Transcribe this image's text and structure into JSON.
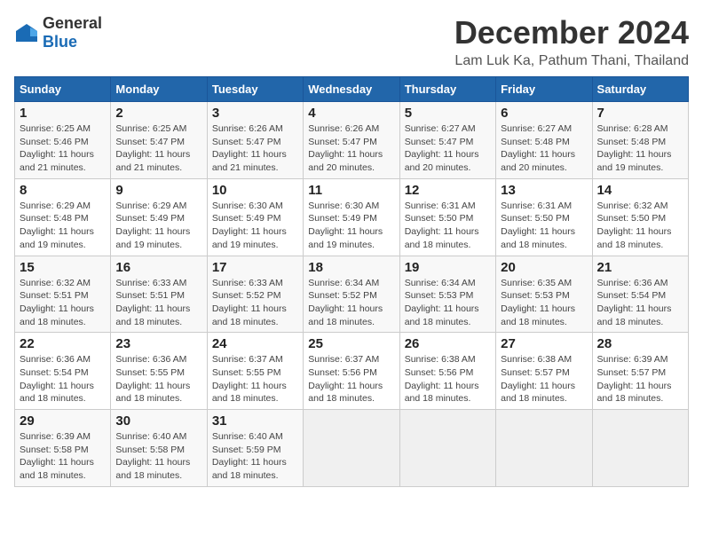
{
  "header": {
    "logo_general": "General",
    "logo_blue": "Blue",
    "title": "December 2024",
    "subtitle": "Lam Luk Ka, Pathum Thani, Thailand"
  },
  "weekdays": [
    "Sunday",
    "Monday",
    "Tuesday",
    "Wednesday",
    "Thursday",
    "Friday",
    "Saturday"
  ],
  "weeks": [
    [
      {
        "day": "1",
        "sunrise": "6:25 AM",
        "sunset": "5:46 PM",
        "daylight": "11 hours and 21 minutes."
      },
      {
        "day": "2",
        "sunrise": "6:25 AM",
        "sunset": "5:47 PM",
        "daylight": "11 hours and 21 minutes."
      },
      {
        "day": "3",
        "sunrise": "6:26 AM",
        "sunset": "5:47 PM",
        "daylight": "11 hours and 21 minutes."
      },
      {
        "day": "4",
        "sunrise": "6:26 AM",
        "sunset": "5:47 PM",
        "daylight": "11 hours and 20 minutes."
      },
      {
        "day": "5",
        "sunrise": "6:27 AM",
        "sunset": "5:47 PM",
        "daylight": "11 hours and 20 minutes."
      },
      {
        "day": "6",
        "sunrise": "6:27 AM",
        "sunset": "5:48 PM",
        "daylight": "11 hours and 20 minutes."
      },
      {
        "day": "7",
        "sunrise": "6:28 AM",
        "sunset": "5:48 PM",
        "daylight": "11 hours and 19 minutes."
      }
    ],
    [
      {
        "day": "8",
        "sunrise": "6:29 AM",
        "sunset": "5:48 PM",
        "daylight": "11 hours and 19 minutes."
      },
      {
        "day": "9",
        "sunrise": "6:29 AM",
        "sunset": "5:49 PM",
        "daylight": "11 hours and 19 minutes."
      },
      {
        "day": "10",
        "sunrise": "6:30 AM",
        "sunset": "5:49 PM",
        "daylight": "11 hours and 19 minutes."
      },
      {
        "day": "11",
        "sunrise": "6:30 AM",
        "sunset": "5:49 PM",
        "daylight": "11 hours and 19 minutes."
      },
      {
        "day": "12",
        "sunrise": "6:31 AM",
        "sunset": "5:50 PM",
        "daylight": "11 hours and 18 minutes."
      },
      {
        "day": "13",
        "sunrise": "6:31 AM",
        "sunset": "5:50 PM",
        "daylight": "11 hours and 18 minutes."
      },
      {
        "day": "14",
        "sunrise": "6:32 AM",
        "sunset": "5:50 PM",
        "daylight": "11 hours and 18 minutes."
      }
    ],
    [
      {
        "day": "15",
        "sunrise": "6:32 AM",
        "sunset": "5:51 PM",
        "daylight": "11 hours and 18 minutes."
      },
      {
        "day": "16",
        "sunrise": "6:33 AM",
        "sunset": "5:51 PM",
        "daylight": "11 hours and 18 minutes."
      },
      {
        "day": "17",
        "sunrise": "6:33 AM",
        "sunset": "5:52 PM",
        "daylight": "11 hours and 18 minutes."
      },
      {
        "day": "18",
        "sunrise": "6:34 AM",
        "sunset": "5:52 PM",
        "daylight": "11 hours and 18 minutes."
      },
      {
        "day": "19",
        "sunrise": "6:34 AM",
        "sunset": "5:53 PM",
        "daylight": "11 hours and 18 minutes."
      },
      {
        "day": "20",
        "sunrise": "6:35 AM",
        "sunset": "5:53 PM",
        "daylight": "11 hours and 18 minutes."
      },
      {
        "day": "21",
        "sunrise": "6:36 AM",
        "sunset": "5:54 PM",
        "daylight": "11 hours and 18 minutes."
      }
    ],
    [
      {
        "day": "22",
        "sunrise": "6:36 AM",
        "sunset": "5:54 PM",
        "daylight": "11 hours and 18 minutes."
      },
      {
        "day": "23",
        "sunrise": "6:36 AM",
        "sunset": "5:55 PM",
        "daylight": "11 hours and 18 minutes."
      },
      {
        "day": "24",
        "sunrise": "6:37 AM",
        "sunset": "5:55 PM",
        "daylight": "11 hours and 18 minutes."
      },
      {
        "day": "25",
        "sunrise": "6:37 AM",
        "sunset": "5:56 PM",
        "daylight": "11 hours and 18 minutes."
      },
      {
        "day": "26",
        "sunrise": "6:38 AM",
        "sunset": "5:56 PM",
        "daylight": "11 hours and 18 minutes."
      },
      {
        "day": "27",
        "sunrise": "6:38 AM",
        "sunset": "5:57 PM",
        "daylight": "11 hours and 18 minutes."
      },
      {
        "day": "28",
        "sunrise": "6:39 AM",
        "sunset": "5:57 PM",
        "daylight": "11 hours and 18 minutes."
      }
    ],
    [
      {
        "day": "29",
        "sunrise": "6:39 AM",
        "sunset": "5:58 PM",
        "daylight": "11 hours and 18 minutes."
      },
      {
        "day": "30",
        "sunrise": "6:40 AM",
        "sunset": "5:58 PM",
        "daylight": "11 hours and 18 minutes."
      },
      {
        "day": "31",
        "sunrise": "6:40 AM",
        "sunset": "5:59 PM",
        "daylight": "11 hours and 18 minutes."
      },
      null,
      null,
      null,
      null
    ]
  ]
}
